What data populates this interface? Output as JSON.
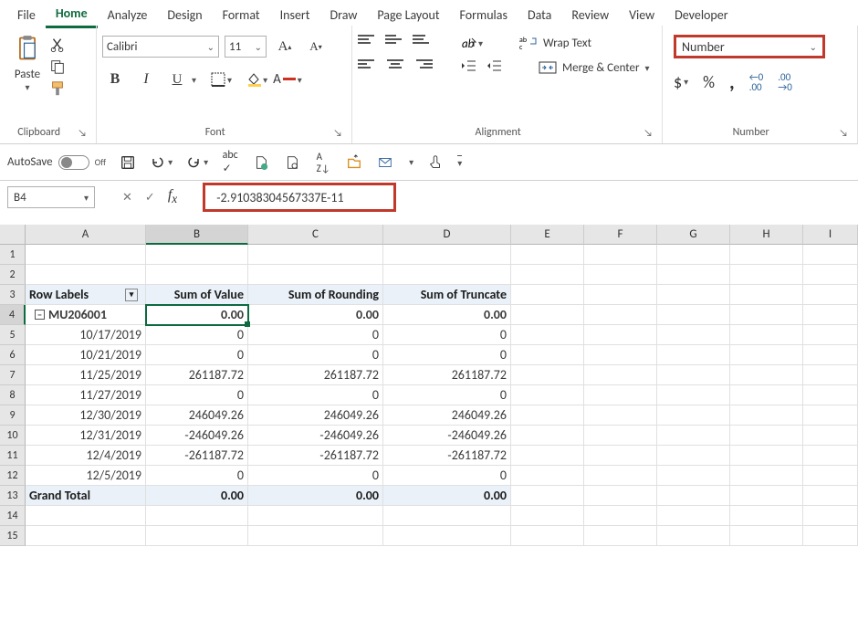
{
  "tabs": [
    "File",
    "Home",
    "Analyze",
    "Design",
    "Format",
    "Insert",
    "Draw",
    "Page Layout",
    "Formulas",
    "Data",
    "Review",
    "View",
    "Developer"
  ],
  "activeTab": "Home",
  "clipboard": {
    "paste": "Paste",
    "label": "Clipboard"
  },
  "font": {
    "name": "Calibri",
    "size": "11",
    "label": "Font"
  },
  "alignment": {
    "wrap": "Wrap Text",
    "merge": "Merge & Center",
    "label": "Alignment"
  },
  "number": {
    "format": "Number",
    "label": "Number"
  },
  "autosave": {
    "label": "AutoSave",
    "state": "Off"
  },
  "nameBox": "B4",
  "formula": "-2.91038304567337E-11",
  "columns": [
    "A",
    "B",
    "C",
    "D",
    "E",
    "F",
    "G",
    "H",
    "I"
  ],
  "rowNums": [
    "1",
    "2",
    "3",
    "4",
    "5",
    "6",
    "7",
    "8",
    "9",
    "10",
    "11",
    "12",
    "13",
    "14",
    "15"
  ],
  "table": {
    "headers": [
      "Row Labels",
      "Sum of Value",
      "Sum of Rounding",
      "Sum of Truncate"
    ],
    "groupLabel": "MU206001",
    "groupVals": [
      "0.00",
      "0.00",
      "0.00"
    ],
    "rows": [
      [
        "10/17/2019",
        "0",
        "0",
        "0"
      ],
      [
        "10/21/2019",
        "0",
        "0",
        "0"
      ],
      [
        "11/25/2019",
        "261187.72",
        "261187.72",
        "261187.72"
      ],
      [
        "11/27/2019",
        "0",
        "0",
        "0"
      ],
      [
        "12/30/2019",
        "246049.26",
        "246049.26",
        "246049.26"
      ],
      [
        "12/31/2019",
        "-246049.26",
        "-246049.26",
        "-246049.26"
      ],
      [
        "12/4/2019",
        "-261187.72",
        "-261187.72",
        "-261187.72"
      ],
      [
        "12/5/2019",
        "0",
        "0",
        "0"
      ]
    ],
    "total": [
      "Grand Total",
      "0.00",
      "0.00",
      "0.00"
    ]
  }
}
